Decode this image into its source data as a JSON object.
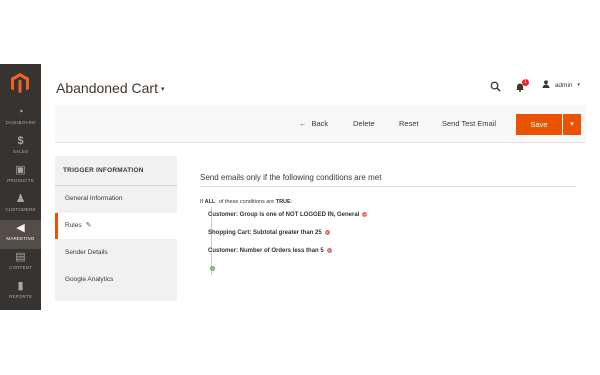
{
  "header": {
    "title": "Abandoned Cart",
    "title_caret": "▾",
    "search_icon": "search-icon",
    "notifications_icon": "bell-icon",
    "notifications_count": "1",
    "user_icon": "user-icon",
    "user_name": "admin",
    "user_caret": "▾"
  },
  "sidebar": {
    "items": [
      {
        "label": "DASHBOARD",
        "icon": "dashboard-icon",
        "glyph": "◔"
      },
      {
        "label": "SALES",
        "icon": "dollar-icon",
        "glyph": "$"
      },
      {
        "label": "PRODUCTS",
        "icon": "cube-icon",
        "glyph": "▣"
      },
      {
        "label": "CUSTOMERS",
        "icon": "customers-icon",
        "glyph": "♟"
      },
      {
        "label": "MARKETING",
        "icon": "megaphone-icon",
        "glyph": "◀"
      },
      {
        "label": "CONTENT",
        "icon": "content-icon",
        "glyph": "▤"
      },
      {
        "label": "REPORTS",
        "icon": "bar-chart-icon",
        "glyph": "▮"
      }
    ],
    "active": "MARKETING"
  },
  "actions": {
    "back": "Back",
    "back_arrow": "←",
    "delete": "Delete",
    "reset": "Reset",
    "send_test": "Send Test Email",
    "save": "Save",
    "save_split_glyph": "▾"
  },
  "tabs": {
    "header": "TRIGGER INFORMATION",
    "items": [
      "General Information",
      "Rules",
      "Sender Details",
      "Google Analytics"
    ],
    "active": "Rules",
    "pencil_glyph": "✎"
  },
  "rules": {
    "title": "Send emails only if the following conditions are met",
    "intro_if": "If",
    "intro_all": "ALL",
    "intro_mid": "of these conditions are",
    "intro_true": "TRUE",
    "intro_end": ":",
    "conditions": [
      "Customer: Group  is one of  NOT LOGGED IN, General",
      "Shopping Cart: Subtotal  greater than  25",
      "Customer: Number of Orders  less than  5"
    ],
    "remove_glyph": "−",
    "add_glyph": "+"
  },
  "colors": {
    "accent": "#eb5202",
    "sidebar_bg": "#373330",
    "sidebar_active": "#524d49"
  }
}
